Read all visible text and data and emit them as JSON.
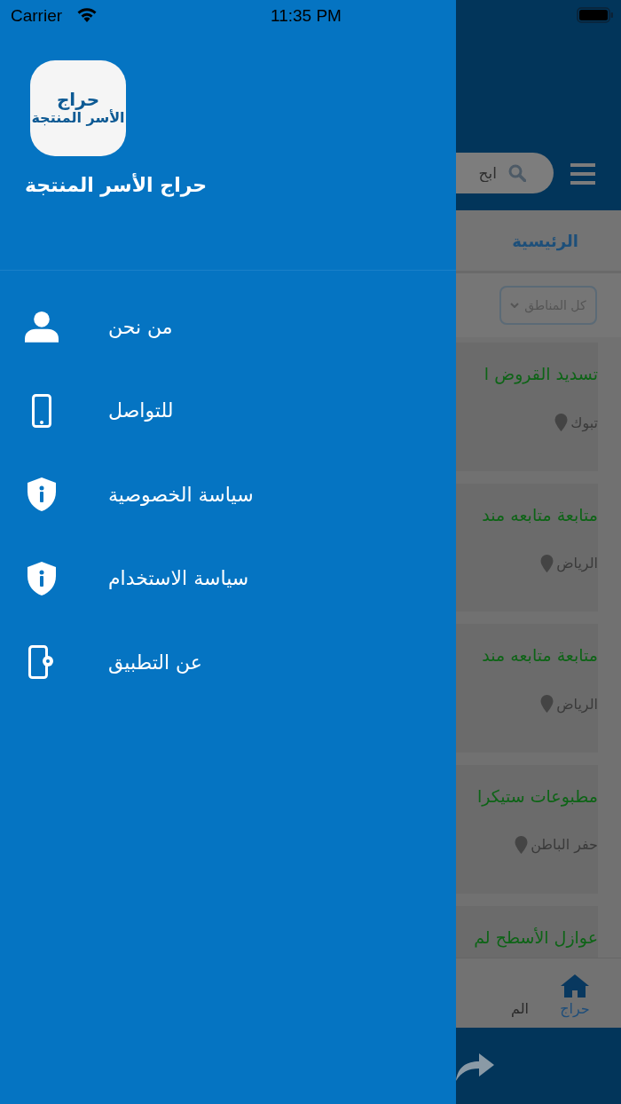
{
  "status_bar": {
    "carrier": "Carrier",
    "time": "11:35 PM"
  },
  "drawer": {
    "logo": {
      "line_1": "حراج",
      "line_2": "الأسر المنتجة"
    },
    "app_name": "حراج الأسر المنتجة",
    "items": [
      {
        "kind": "person",
        "label": "من نحن"
      },
      {
        "kind": "phone",
        "label": "للتواصل"
      },
      {
        "kind": "shield",
        "label": "سياسة الخصوصية"
      },
      {
        "kind": "shield",
        "label": "سياسة الاستخدام"
      },
      {
        "kind": "phone-settings",
        "label": "عن التطبيق"
      }
    ]
  },
  "background": {
    "search": {
      "placeholder": "ابح"
    },
    "tab": "الرئيسية",
    "filter": "كل المناطق",
    "listings": [
      {
        "title": "تسديد القروض ا",
        "location": "تبوك"
      },
      {
        "title": "متابعة متابعه مند",
        "location": "الرياض"
      },
      {
        "title": "متابعة متابعه مند",
        "location": "الرياض"
      },
      {
        "title": "مطبوعات ستيكرا",
        "location": "حفر الباطن"
      },
      {
        "title": "عوازل الأسطح لم"
      }
    ],
    "bottom_tabs": [
      {
        "label": "حراج",
        "selected": true
      },
      {
        "label": "الم",
        "selected": false
      }
    ]
  }
}
